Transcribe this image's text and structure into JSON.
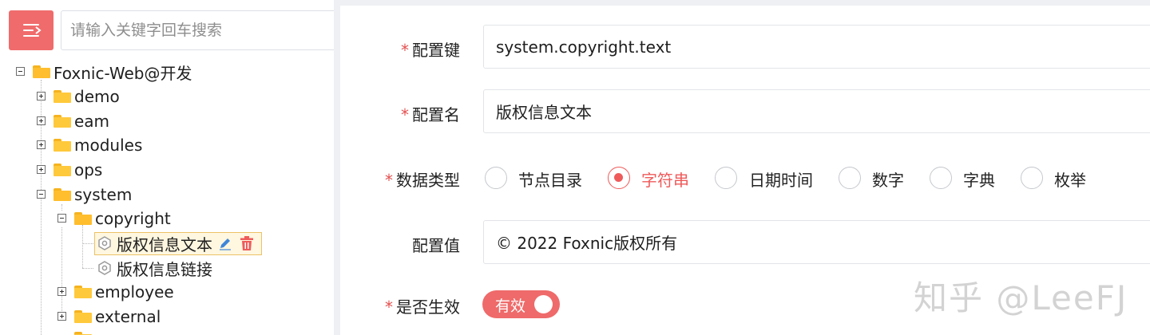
{
  "search": {
    "placeholder": "请输入关键字回车搜索"
  },
  "tree": {
    "root": "Foxnic-Web@开发",
    "children": [
      "demo",
      "eam",
      "modules",
      "ops",
      "system"
    ],
    "system_children": [
      "copyright",
      "employee",
      "external"
    ],
    "copyright_children": [
      "版权信息文本",
      "版权信息链接"
    ]
  },
  "form": {
    "key_label": "配置键",
    "key_value": "system.copyright.text",
    "name_label": "配置名",
    "name_value": "版权信息文本",
    "type_label": "数据类型",
    "type_options": [
      "节点目录",
      "字符串",
      "日期时间",
      "数字",
      "字典",
      "枚举"
    ],
    "type_selected": "字符串",
    "value_label": "配置值",
    "value_value": "© 2022 Foxnic版权所有",
    "valid_label": "是否生效",
    "valid_switch": "有效",
    "required_mark": "*"
  },
  "watermark": "知乎 @LeeFJ",
  "colors": {
    "accent": "#ef5b5b",
    "folder": "#ffc93c",
    "selected_bg": "#fff7e0"
  },
  "icons": {
    "menu": "indent-menu-icon",
    "folder": "folder-icon",
    "leaf": "config-node-icon",
    "edit": "pencil-icon",
    "delete": "trash-icon"
  }
}
